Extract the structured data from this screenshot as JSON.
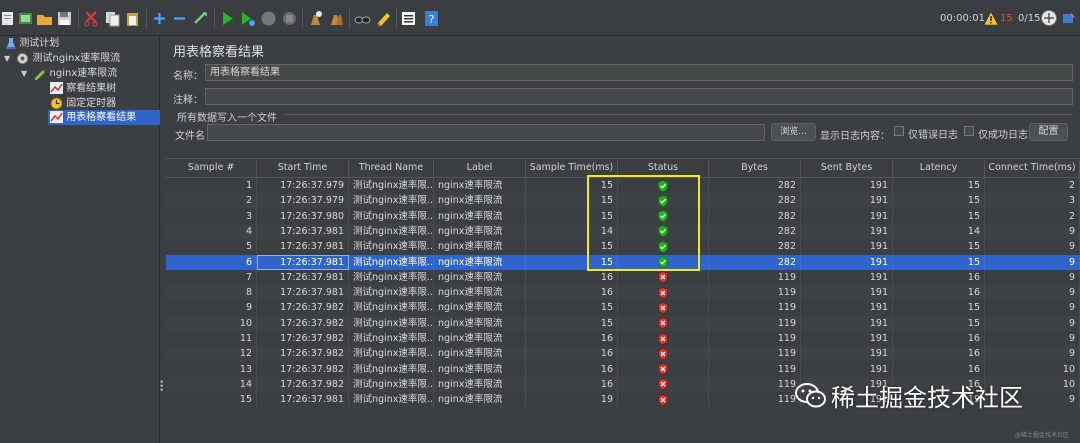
{
  "toolbar": {
    "icons": [
      "template-icon",
      "open-icon",
      "open-folder-icon",
      "save-icon",
      "cut-icon",
      "copy-icon",
      "paste-icon",
      "expand-icon",
      "collapse-icon",
      "toggle-icon",
      "start-icon",
      "start-no-pause-icon",
      "stop-icon",
      "shutdown-icon",
      "clear-icon",
      "clear-all-icon",
      "search-icon",
      "reset-search-icon",
      "function-helper-icon",
      "help-icon"
    ],
    "timer": "00:00:01",
    "error_count": "15",
    "threads": "0/15"
  },
  "tree": {
    "items": [
      {
        "label": "测试计划",
        "icon": "test-plan-icon",
        "indent": 0
      },
      {
        "label": "测试nginx速率限流",
        "icon": "thread-group-gear-icon",
        "indent": 1
      },
      {
        "label": "nginx速率限流",
        "icon": "http-sampler-pen-icon",
        "indent": 2
      },
      {
        "label": "察看结果树",
        "icon": "listener-graph-icon",
        "indent": 3
      },
      {
        "label": "固定定时器",
        "icon": "timer-clock-icon",
        "indent": 3
      },
      {
        "label": "用表格察看结果",
        "icon": "listener-graph-icon",
        "indent": 3
      }
    ]
  },
  "panel": {
    "title": "用表格察看结果",
    "name_label": "名称：",
    "name_value": "用表格察看结果",
    "comment_label": "注释：",
    "comment_value": "",
    "group_label": "所有数据写入一个文件",
    "file_label": "文件名",
    "file_value": "",
    "browse_label": "浏览...",
    "log_content_label": "显示日志内容：",
    "errors_only_label": "仅错误日志",
    "success_only_label": "仅成功日志",
    "config_label": "配置"
  },
  "table": {
    "columns": [
      "Sample #",
      "Start Time",
      "Thread Name",
      "Label",
      "Sample Time(ms)",
      "Status",
      "Bytes",
      "Sent Bytes",
      "Latency",
      "Connect Time(ms)"
    ],
    "rows": [
      {
        "n": "1",
        "start": "17:26:37.979",
        "thread": "测试nginx速率限...",
        "label": "nginx速率限流",
        "time": "15",
        "status": "success",
        "bytes": "282",
        "sent": "191",
        "latency": "15",
        "connect": "2"
      },
      {
        "n": "2",
        "start": "17:26:37.979",
        "thread": "测试nginx速率限...",
        "label": "nginx速率限流",
        "time": "15",
        "status": "success",
        "bytes": "282",
        "sent": "191",
        "latency": "15",
        "connect": "3"
      },
      {
        "n": "3",
        "start": "17:26:37.980",
        "thread": "测试nginx速率限...",
        "label": "nginx速率限流",
        "time": "15",
        "status": "success",
        "bytes": "282",
        "sent": "191",
        "latency": "15",
        "connect": "2"
      },
      {
        "n": "4",
        "start": "17:26:37.981",
        "thread": "测试nginx速率限...",
        "label": "nginx速率限流",
        "time": "14",
        "status": "success",
        "bytes": "282",
        "sent": "191",
        "latency": "14",
        "connect": "9"
      },
      {
        "n": "5",
        "start": "17:26:37.981",
        "thread": "测试nginx速率限...",
        "label": "nginx速率限流",
        "time": "15",
        "status": "success",
        "bytes": "282",
        "sent": "191",
        "latency": "15",
        "connect": "9"
      },
      {
        "n": "6",
        "start": "17:26:37.981",
        "thread": "测试nginx速率限...",
        "label": "nginx速率限流",
        "time": "15",
        "status": "success",
        "bytes": "282",
        "sent": "191",
        "latency": "15",
        "connect": "9"
      },
      {
        "n": "7",
        "start": "17:26:37.981",
        "thread": "测试nginx速率限...",
        "label": "nginx速率限流",
        "time": "16",
        "status": "error",
        "bytes": "119",
        "sent": "191",
        "latency": "16",
        "connect": "9"
      },
      {
        "n": "8",
        "start": "17:26:37.981",
        "thread": "测试nginx速率限...",
        "label": "nginx速率限流",
        "time": "16",
        "status": "error",
        "bytes": "119",
        "sent": "191",
        "latency": "16",
        "connect": "9"
      },
      {
        "n": "9",
        "start": "17:26:37.982",
        "thread": "测试nginx速率限...",
        "label": "nginx速率限流",
        "time": "15",
        "status": "error",
        "bytes": "119",
        "sent": "191",
        "latency": "15",
        "connect": "9"
      },
      {
        "n": "10",
        "start": "17:26:37.982",
        "thread": "测试nginx速率限...",
        "label": "nginx速率限流",
        "time": "15",
        "status": "error",
        "bytes": "119",
        "sent": "191",
        "latency": "15",
        "connect": "9"
      },
      {
        "n": "11",
        "start": "17:26:37.982",
        "thread": "测试nginx速率限...",
        "label": "nginx速率限流",
        "time": "16",
        "status": "error",
        "bytes": "119",
        "sent": "191",
        "latency": "16",
        "connect": "9"
      },
      {
        "n": "12",
        "start": "17:26:37.982",
        "thread": "测试nginx速率限...",
        "label": "nginx速率限流",
        "time": "16",
        "status": "error",
        "bytes": "119",
        "sent": "191",
        "latency": "16",
        "connect": "9"
      },
      {
        "n": "13",
        "start": "17:26:37.982",
        "thread": "测试nginx速率限...",
        "label": "nginx速率限流",
        "time": "16",
        "status": "error",
        "bytes": "119",
        "sent": "191",
        "latency": "16",
        "connect": "10"
      },
      {
        "n": "14",
        "start": "17:26:37.982",
        "thread": "测试nginx速率限...",
        "label": "nginx速率限流",
        "time": "16",
        "status": "error",
        "bytes": "119",
        "sent": "191",
        "latency": "16",
        "connect": "10"
      },
      {
        "n": "15",
        "start": "17:26:37.981",
        "thread": "测试nginx速率限...",
        "label": "nginx速率限流",
        "time": "19",
        "status": "error",
        "bytes": "119",
        "sent": "191",
        "latency": "19",
        "connect": "9"
      }
    ],
    "selected_row": "6"
  },
  "watermark": {
    "text": "稀土掘金技术社区",
    "small": "@稀土掘金技术社区",
    "icon": "wechat-icon"
  },
  "colors": {
    "accent_selection": "#2f65ca",
    "highlight_box": "#f5ea1f",
    "success": "#1fb31f",
    "error": "#d93030"
  }
}
